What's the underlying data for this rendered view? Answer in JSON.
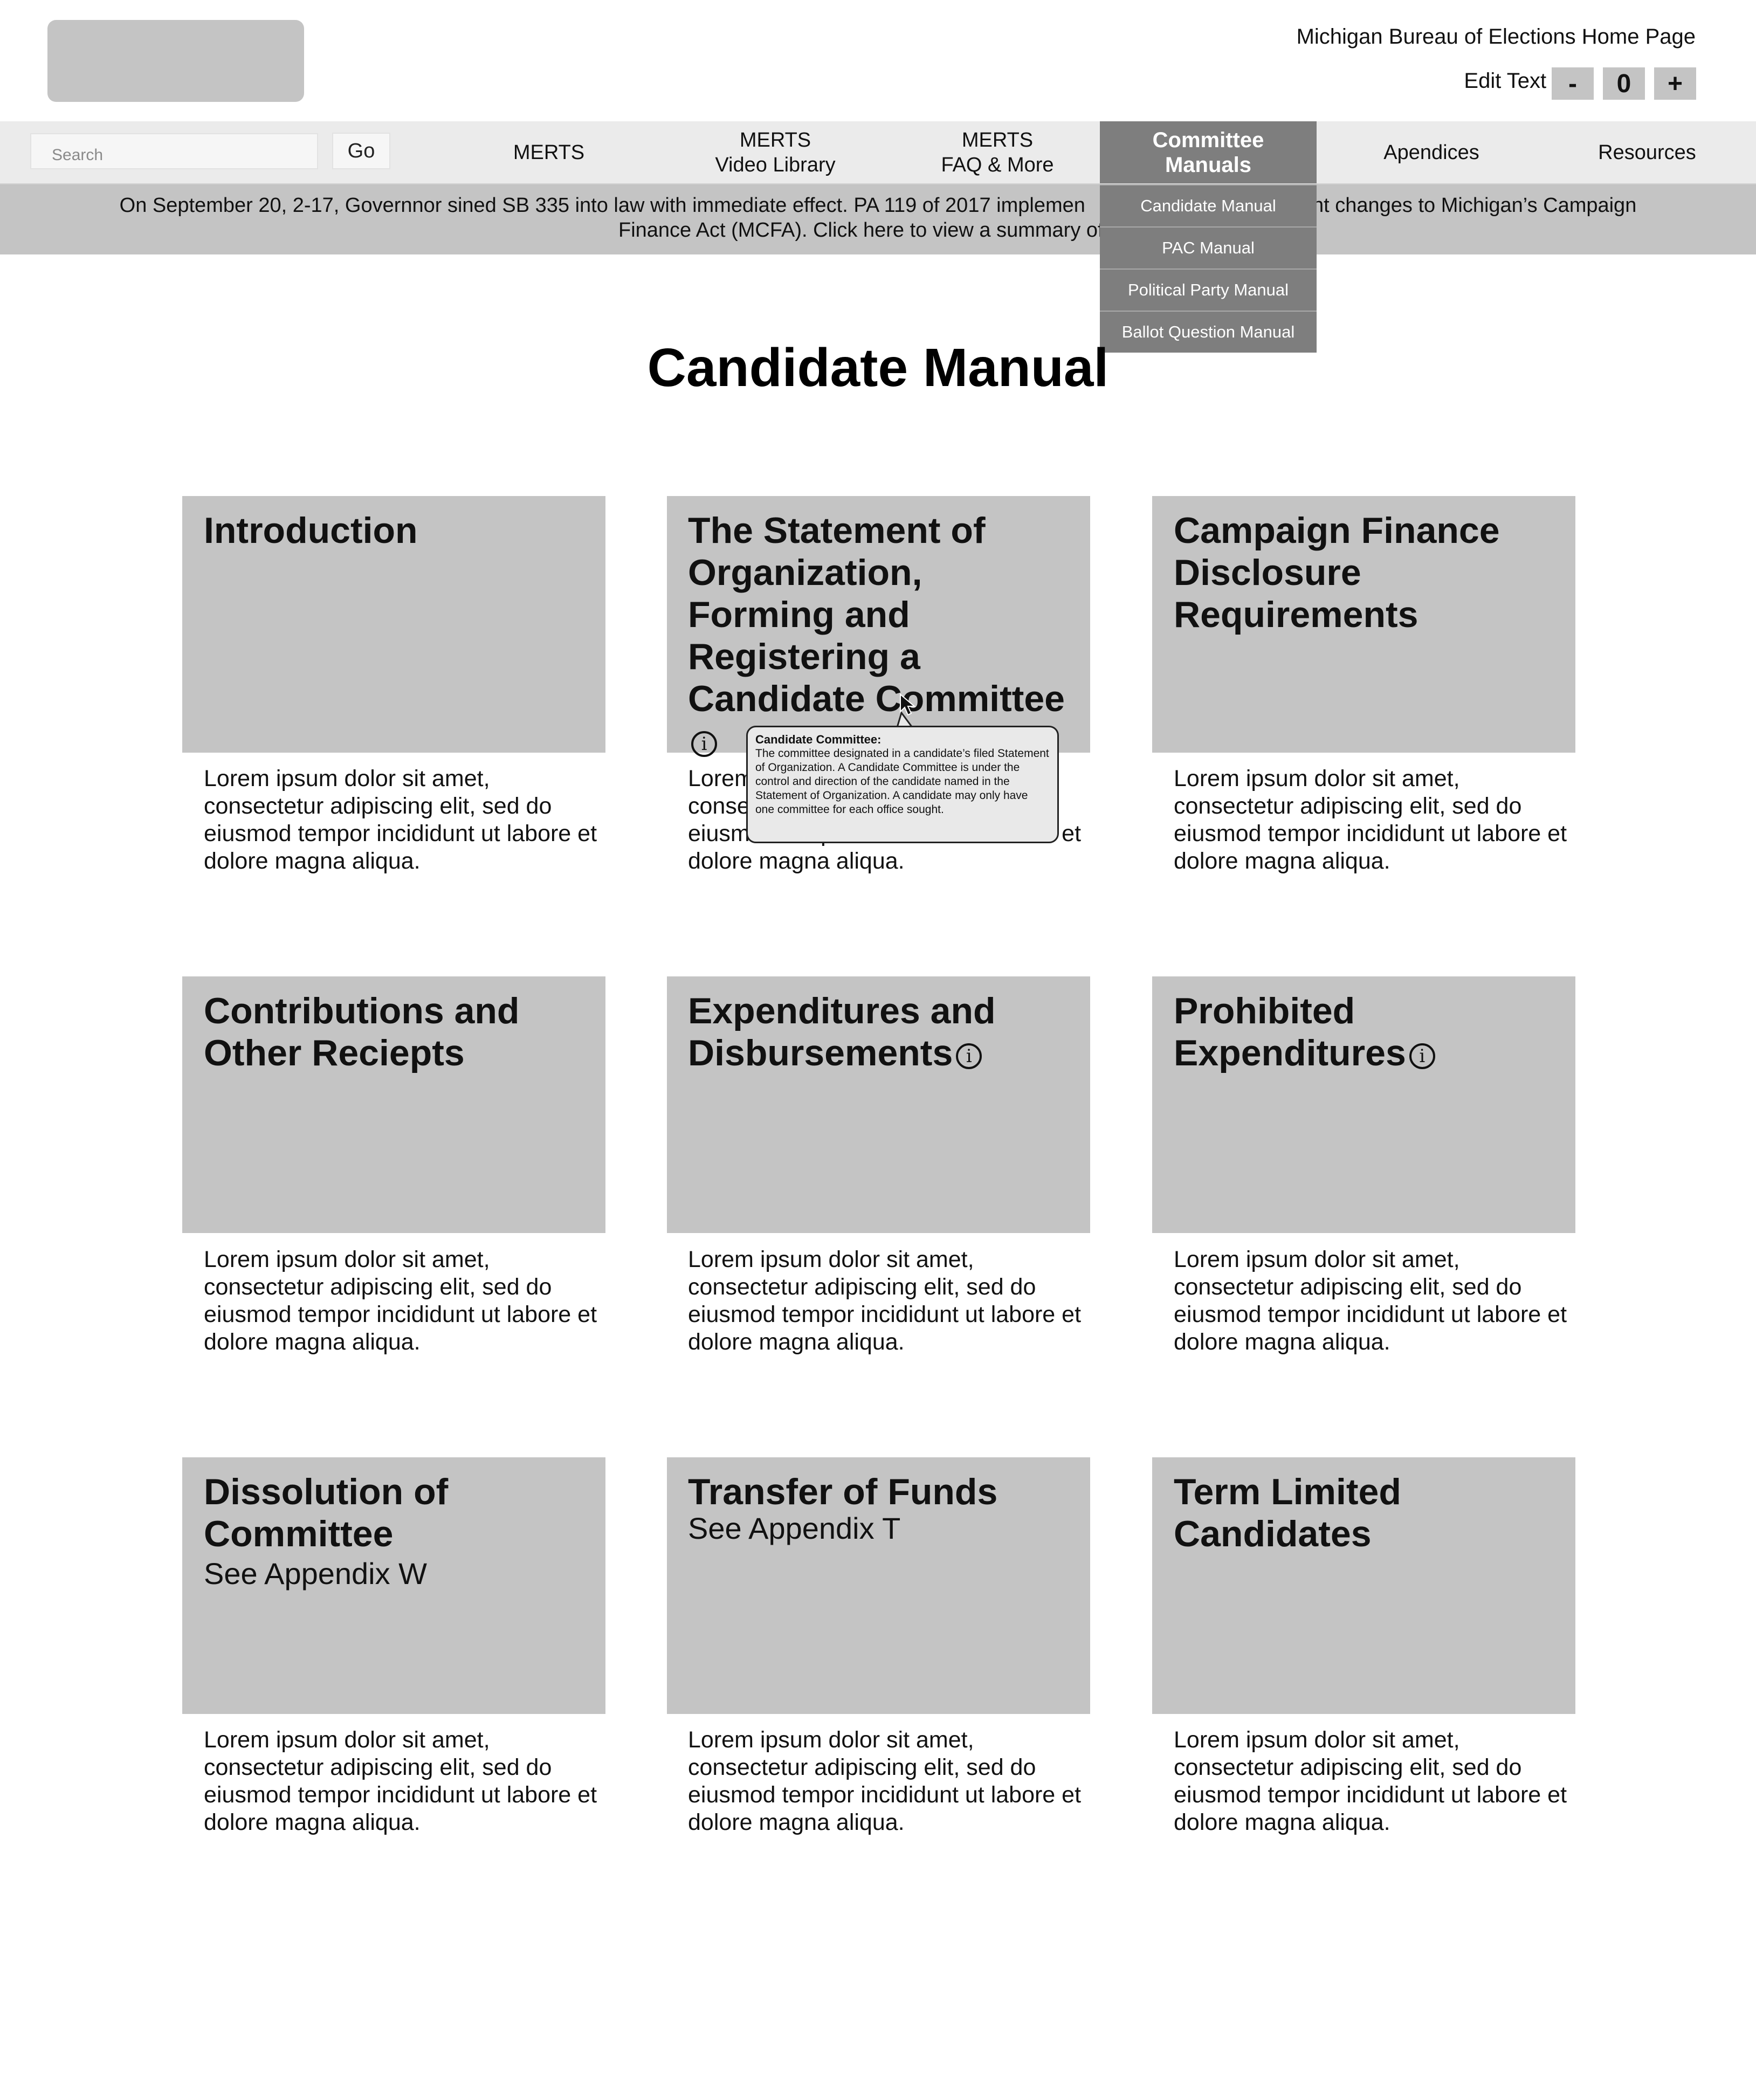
{
  "header": {
    "home_link": "Michigan Bureau of Elections Home Page",
    "text_size_label": "Edit Text Size",
    "decrease_label": "-",
    "size_value": "0",
    "increase_label": "+"
  },
  "search": {
    "placeholder": "Search",
    "go_label": "Go"
  },
  "nav": {
    "merts": "MERTS",
    "video_line1": "MERTS",
    "video_line2": "Video Library",
    "faq_line1": "MERTS",
    "faq_line2": "FAQ & More",
    "committee_line1": "Committee",
    "committee_line2": "Manuals",
    "apendices": "Apendices",
    "resources": "Resources"
  },
  "dropdown": {
    "items": [
      "Candidate Manual",
      "PAC Manual",
      "Political Party Manual",
      "Ballot Question Manual"
    ]
  },
  "banner": {
    "line1": "On September 20, 2-17, Governnor sined SB 335 into law with immediate effect. PA 119 of 2017 implemen",
    "line1_end": "ant changes to Michigan’s Campaign",
    "line2": "Finance Act (MCFA). Click here to view a summary of the"
  },
  "page_title": "Candidate Manual",
  "cards": [
    {
      "title": "Introduction",
      "subtitle": "",
      "body": "Lorem ipsum dolor sit amet, consectetur adipiscing elit, sed do eiusmod tempor incididunt ut labore et dolore magna aliqua."
    },
    {
      "title": "The Statement of Organization, Forming and Registering a Candidate Committee",
      "subtitle": "",
      "body": "Lorem ipsum dolor sit amet, consectetur adipiscing elit, sed do eiusmod tempor incididunt ut labore et dolore magna aliqua."
    },
    {
      "title": "Campaign Finance Disclosure Requirements",
      "subtitle": "",
      "body": "Lorem ipsum dolor sit amet, consectetur adipiscing elit, sed do eiusmod tempor incididunt ut labore et dolore magna aliqua."
    },
    {
      "title": "Contributions and Other Reciepts",
      "subtitle": "",
      "body": "Lorem ipsum dolor sit amet, consectetur adipiscing elit, sed do eiusmod tempor incididunt ut labore et dolore magna aliqua."
    },
    {
      "title": "Expenditures and Disbursements",
      "subtitle": "",
      "body": "Lorem ipsum dolor sit amet, consectetur adipiscing elit, sed do eiusmod tempor incididunt ut labore et dolore magna aliqua."
    },
    {
      "title": "Prohibited Expenditures",
      "subtitle": "",
      "body": "Lorem ipsum dolor sit amet, consectetur adipiscing elit, sed do eiusmod tempor incididunt ut labore et dolore magna aliqua."
    },
    {
      "title": "Dissolution of Committee",
      "subtitle": "See Appendix W",
      "body": "Lorem ipsum dolor sit amet, consectetur adipiscing elit, sed do eiusmod tempor incididunt ut labore et dolore magna aliqua."
    },
    {
      "title": "Transfer of Funds",
      "subtitle": "See Appendix T",
      "body": "Lorem ipsum dolor sit amet, consectetur adipiscing elit, sed do eiusmod tempor incididunt ut labore et dolore magna aliqua."
    },
    {
      "title": "Term Limited Candidates",
      "subtitle": "",
      "body": "Lorem ipsum dolor sit amet, consectetur adipiscing elit, sed do eiusmod tempor incididunt ut labore et dolore magna aliqua."
    }
  ],
  "tooltip": {
    "title": "Candidate Committee:",
    "body": "The committee designated in a candidate’s filed Statement of Organization. A Candidate Committee is under the control and direction of the candidate named in the Statement of Organization. A candidate may only have one committee for each office sought."
  },
  "icons": {
    "info": "info-icon",
    "cursor": "cursor-arrow-icon"
  },
  "colors": {
    "card_gray": "#c4c4c4",
    "nav_active": "#7e7e7e",
    "nav_bg": "#ebebeb"
  }
}
